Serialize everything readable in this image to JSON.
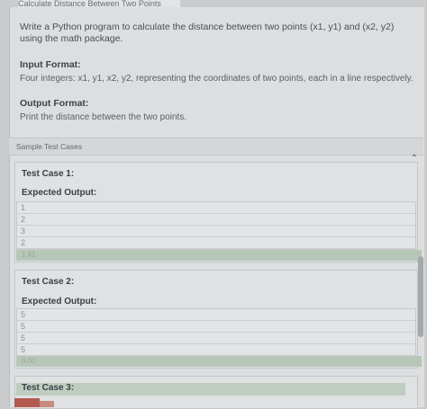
{
  "header": {
    "title": "Calculate Distance Between Two Points"
  },
  "problem": {
    "description": "Write a Python program to calculate the distance between two points (x1, y1) and (x2, y2) using the math package.",
    "input_label": "Input Format:",
    "input_text": "Four integers: x1, y1, x2, y2, representing the coordinates of two points, each in a line respectively.",
    "output_label": "Output Format:",
    "output_text": "Print the distance between the two points."
  },
  "samples": {
    "label": "Sample Test Cases",
    "cases": [
      {
        "title": "Test Case 1:",
        "expected_label": "Expected Output:",
        "lines": [
          "1",
          "2",
          "3",
          "2"
        ],
        "result": "1.41"
      },
      {
        "title": "Test Case 2:",
        "expected_label": "Expected Output:",
        "lines": [
          "5",
          "5",
          "5",
          "5"
        ],
        "result": "0.00"
      },
      {
        "title": "Test Case 3:"
      }
    ]
  }
}
